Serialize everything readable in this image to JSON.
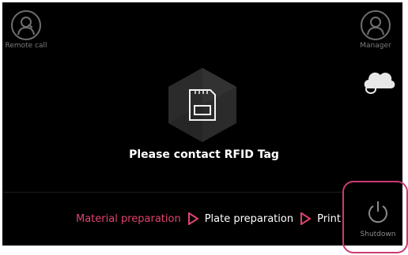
{
  "header": {
    "remote_call_label": "Remote call",
    "manager_label": "Manager"
  },
  "main": {
    "message": "Please contact RFID Tag"
  },
  "workflow": {
    "steps": [
      {
        "label": "Material preparation",
        "state": "active"
      },
      {
        "label": "Plate preparation",
        "state": "inactive"
      },
      {
        "label": "Print",
        "state": "inactive"
      }
    ]
  },
  "footer": {
    "shutdown_label": "Shutdown"
  },
  "colors": {
    "accent": "#e0446f",
    "background": "#000000",
    "frame": "#cc3a73"
  },
  "icons": [
    "remote-call-icon",
    "manager-icon",
    "cloud-sync-icon",
    "sd-card-icon",
    "step-arrow-icon",
    "power-icon"
  ]
}
